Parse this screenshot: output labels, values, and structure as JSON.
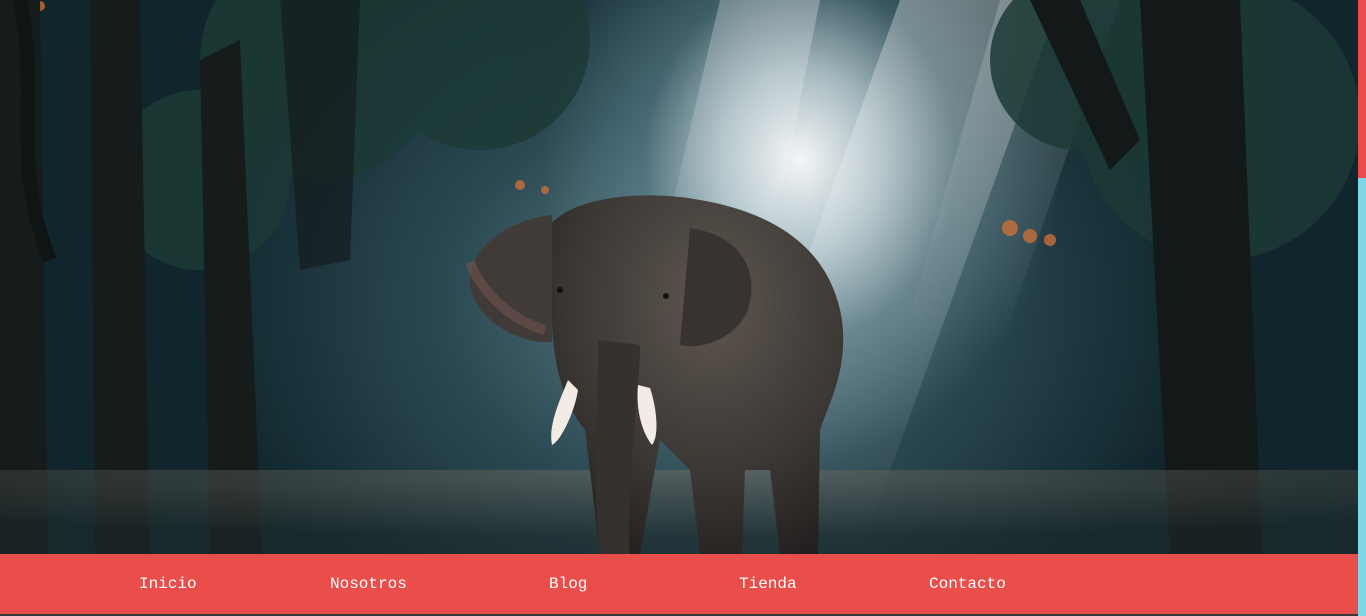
{
  "hero": {
    "image": "elephant-in-misty-forest"
  },
  "nav": {
    "items": [
      {
        "label": "Inicio"
      },
      {
        "label": "Nosotros"
      },
      {
        "label": "Blog"
      },
      {
        "label": "Tienda"
      },
      {
        "label": "Contacto"
      }
    ]
  },
  "colors": {
    "nav_background": "#e94e4a",
    "nav_text": "#ffffff",
    "scrollbar_track": "#7fd6e6",
    "scrollbar_thumb": "#e84c4b"
  }
}
